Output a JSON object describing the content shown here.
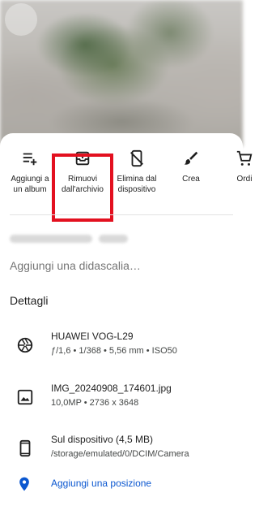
{
  "actions": [
    {
      "label": "Aggiungi a\nun album",
      "icon": "playlist-add-icon"
    },
    {
      "label": "Rimuovi\ndall'archivio",
      "icon": "unarchive-icon"
    },
    {
      "label": "Elimina dal\ndispositivo",
      "icon": "phone-delete-icon"
    },
    {
      "label": "Crea",
      "icon": "brush-icon"
    },
    {
      "label": "Ordi",
      "icon": "cart-icon"
    }
  ],
  "caption": {
    "placeholder": "Aggiungi una didascalia…"
  },
  "details": {
    "title": "Dettagli",
    "camera": {
      "model": "HUAWEI VOG-L29",
      "specs": "ƒ/1,6  •  1/368  •  5,56 mm  •  ISO50",
      "icon": "aperture-icon"
    },
    "file": {
      "name": "IMG_20240908_174601.jpg",
      "info": "10,0MP  •  2736 x 3648",
      "icon": "image-icon"
    },
    "device": {
      "title": "Sul dispositivo (4,5 MB)",
      "path": "/storage/emulated/0/DCIM/Camera",
      "icon": "smartphone-icon"
    }
  },
  "location": {
    "label": "Aggiungi una posizione",
    "icon": "location-pin-icon"
  },
  "colors": {
    "highlight": "#e3101f",
    "link": "#0b57d0"
  }
}
